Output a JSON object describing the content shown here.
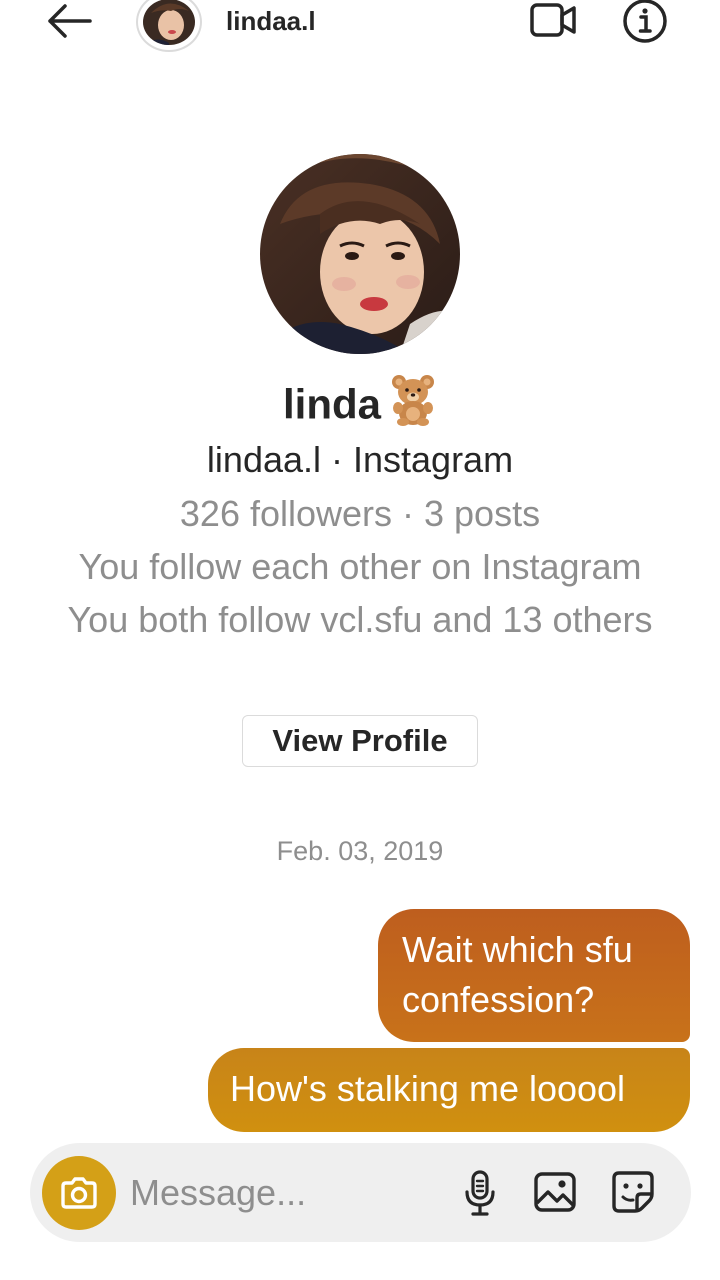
{
  "header": {
    "username": "lindaa.l",
    "icons": {
      "back": "arrow-left-icon",
      "video": "video-camera-icon",
      "info": "info-icon"
    }
  },
  "profile": {
    "name": "linda",
    "emoji": "teddy-bear-emoji",
    "handle_line": "lindaa.l · Instagram",
    "stats_line": "326 followers · 3 posts",
    "follow_line": "You follow each other on Instagram",
    "mutual_line": "You both follow vcl.sfu and 13 others",
    "view_profile_label": "View Profile"
  },
  "conversation": {
    "date": "Feb. 03, 2019",
    "messages": [
      {
        "text": "Wait which sfu confession?",
        "sender": "me"
      },
      {
        "text": "How's stalking me looool",
        "sender": "me"
      }
    ]
  },
  "composer": {
    "placeholder": "Message...",
    "icons": {
      "camera": "camera-icon",
      "mic": "microphone-icon",
      "gallery": "gallery-icon",
      "sticker": "sticker-icon"
    }
  },
  "colors": {
    "bubble_top": "#be5e1e",
    "bubble_bottom": "#d0900f",
    "camera_button": "#d4a017",
    "muted_text": "#8e8e8e"
  }
}
